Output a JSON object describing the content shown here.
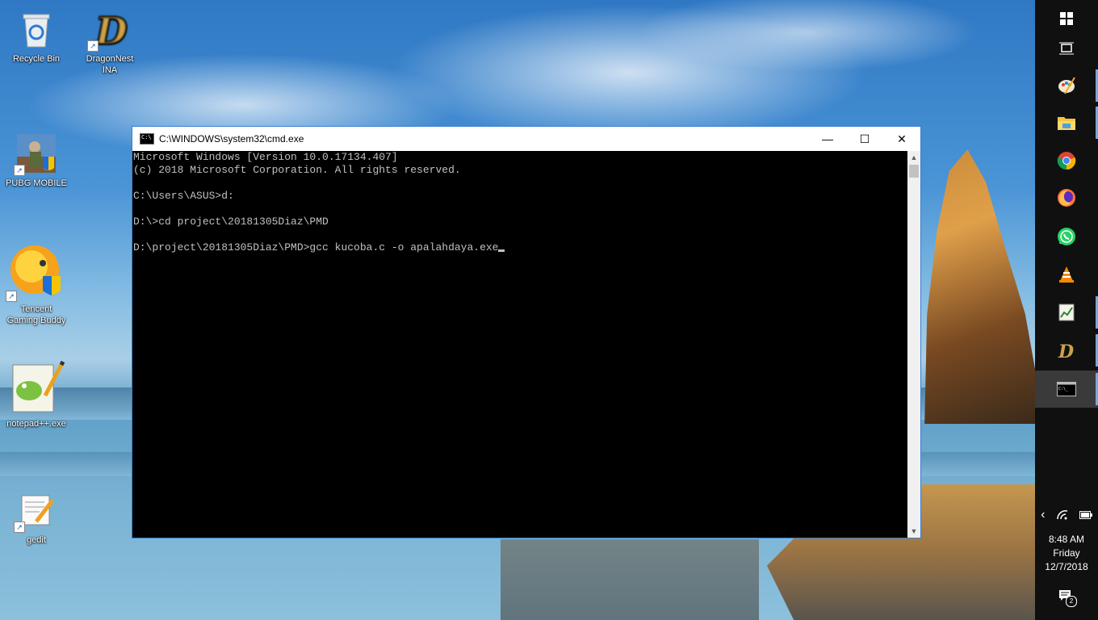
{
  "desktop": {
    "icons": [
      {
        "label": "Recycle Bin"
      },
      {
        "label": "DragonNest INA"
      },
      {
        "label": "PUBG MOBILE"
      },
      {
        "label": "Tencent Gaming Buddy"
      },
      {
        "label": "notepad++.exe"
      },
      {
        "label": "gedit"
      }
    ]
  },
  "cmd": {
    "title": "C:\\WINDOWS\\system32\\cmd.exe",
    "lines": [
      "Microsoft Windows [Version 10.0.17134.407]",
      "(c) 2018 Microsoft Corporation. All rights reserved.",
      "",
      "C:\\Users\\ASUS>d:",
      "",
      "D:\\>cd project\\20181305Diaz\\PMD",
      "",
      "D:\\project\\20181305Diaz\\PMD>gcc kucoba.c -o apalahdaya.exe"
    ],
    "minimize_glyph": "—",
    "maximize_glyph": "☐",
    "close_glyph": "✕"
  },
  "taskbar": {
    "apps": [
      {
        "icon": "windows-start-icon"
      },
      {
        "icon": "task-view-icon"
      },
      {
        "icon": "paint-icon"
      },
      {
        "icon": "file-explorer-icon"
      },
      {
        "icon": "chrome-icon"
      },
      {
        "icon": "firefox-icon"
      },
      {
        "icon": "whatsapp-icon"
      },
      {
        "icon": "vlc-icon"
      },
      {
        "icon": "task-manager-icon"
      },
      {
        "icon": "dragonnest-icon"
      },
      {
        "icon": "cmd-icon"
      }
    ],
    "tray": {
      "time": "8:48 AM",
      "day": "Friday",
      "date": "12/7/2018",
      "notification_count": "2"
    }
  }
}
